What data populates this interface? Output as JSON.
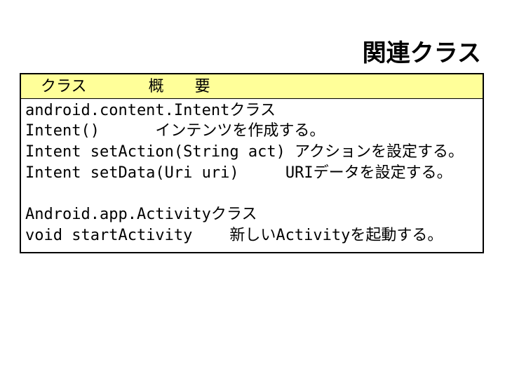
{
  "title": "関連クラス",
  "header": {
    "col1": "　クラス",
    "col2": "　　　　概　　要"
  },
  "body": {
    "line1": "android.content.Intentクラス",
    "line2": "Intent()      インテンツを作成する。",
    "line3": "Intent setAction(String act) アクションを設定する。",
    "line4": "Intent setData(Uri uri)     URIデータを設定する。",
    "blank": " ",
    "line5": "Android.app.Activityクラス",
    "line6": "void startActivity    新しいActivityを起動する。"
  }
}
